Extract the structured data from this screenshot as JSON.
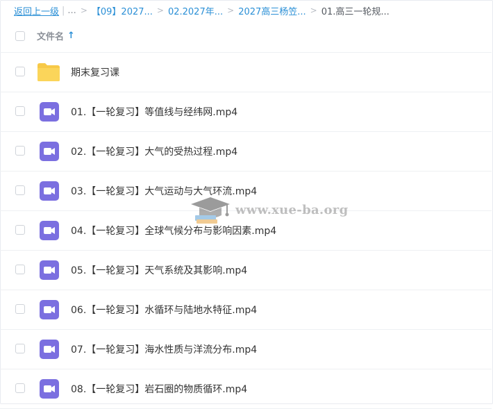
{
  "breadcrumb": {
    "back": "返回上一级",
    "pipe": "|",
    "ellipsis": "...",
    "sep": ">",
    "crumbs": [
      "【09】2027...",
      "02.2027年...",
      "2027高三杨笠...",
      "01.高三一轮规..."
    ]
  },
  "header": {
    "filename_label": "文件名",
    "sort_arrow": "↑"
  },
  "files": [
    {
      "name": "期末复习课",
      "type": "folder"
    },
    {
      "name": "01.【一轮复习】等值线与经纬网.mp4",
      "type": "video"
    },
    {
      "name": "02.【一轮复习】大气的受热过程.mp4",
      "type": "video"
    },
    {
      "name": "03.【一轮复习】大气运动与大气环流.mp4",
      "type": "video"
    },
    {
      "name": "04.【一轮复习】全球气候分布与影响因素.mp4",
      "type": "video"
    },
    {
      "name": "05.【一轮复习】天气系统及其影响.mp4",
      "type": "video"
    },
    {
      "name": "06.【一轮复习】水循环与陆地水特征.mp4",
      "type": "video"
    },
    {
      "name": "07.【一轮复习】海水性质与洋流分布.mp4",
      "type": "video"
    },
    {
      "name": "08.【一轮复习】岩石圈的物质循环.mp4",
      "type": "video"
    }
  ],
  "watermark": {
    "text": "www.xue-ba.org"
  },
  "colors": {
    "link": "#2a8fd6",
    "folder": "#f7c948",
    "video": "#7b6fe0"
  }
}
